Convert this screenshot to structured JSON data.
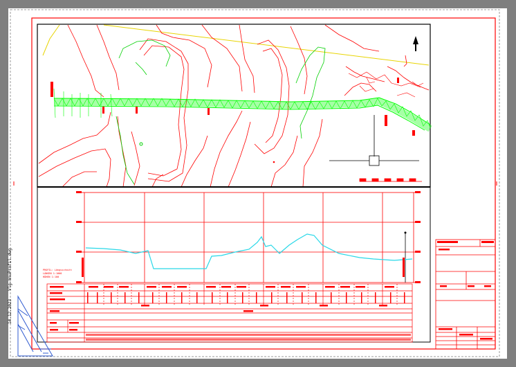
{
  "sheet": {
    "background": "#7f7f7f",
    "paper_color": "#ffffff",
    "frame_color": "#ff0000",
    "terrain_color": "#ff0000",
    "route_color": "#00ff00",
    "profile_color": "#00ffff",
    "boundary_color": "#ffff00"
  },
  "margin_notes": {
    "filename": "Vlg-mnuProfil.dwg",
    "date": "14.12.2023"
  },
  "north_arrow": {
    "icon": "north-arrow-icon"
  },
  "profile": {
    "legend_lines": [
      "PROFIL: Längsschnitt",
      "LÄNGEN 1:1000",
      "HÖHEN 1:100"
    ],
    "elevation_label_left": "Höhe",
    "elevation_label_right": "Höhe"
  }
}
